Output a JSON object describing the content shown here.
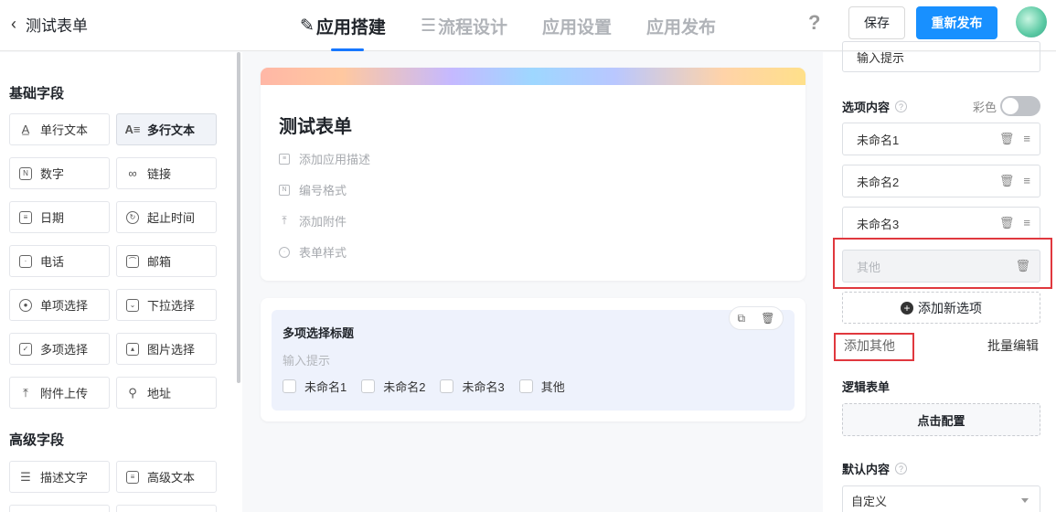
{
  "header": {
    "back_label": "测试表单",
    "tabs": [
      {
        "label": "应用搭建",
        "icon": "edit-icon"
      },
      {
        "label": "流程设计",
        "icon": "flow-icon"
      },
      {
        "label": "应用设置"
      },
      {
        "label": "应用发布"
      }
    ],
    "help": "?",
    "save_label": "保存",
    "publish_label": "重新发布"
  },
  "left": {
    "basic_title": "基础字段",
    "basic_fields": [
      {
        "label": "单行文本",
        "icon": "single-line-text-icon"
      },
      {
        "label": "多行文本",
        "icon": "multi-line-text-icon"
      },
      {
        "label": "数字",
        "icon": "number-icon"
      },
      {
        "label": "链接",
        "icon": "link-icon"
      },
      {
        "label": "日期",
        "icon": "calendar-icon"
      },
      {
        "label": "起止时间",
        "icon": "time-range-icon"
      },
      {
        "label": "电话",
        "icon": "phone-icon"
      },
      {
        "label": "邮箱",
        "icon": "mail-icon"
      },
      {
        "label": "单项选择",
        "icon": "radio-icon"
      },
      {
        "label": "下拉选择",
        "icon": "dropdown-icon"
      },
      {
        "label": "多项选择",
        "icon": "checkbox-icon"
      },
      {
        "label": "图片选择",
        "icon": "image-icon"
      },
      {
        "label": "附件上传",
        "icon": "upload-icon"
      },
      {
        "label": "地址",
        "icon": "location-icon"
      }
    ],
    "advanced_title": "高级字段",
    "advanced_fields": [
      {
        "label": "描述文字",
        "icon": "description-icon"
      },
      {
        "label": "高级文本",
        "icon": "rich-text-icon"
      }
    ]
  },
  "canvas": {
    "form_title": "测试表单",
    "meta": [
      {
        "label": "添加应用描述",
        "icon": "comment-icon"
      },
      {
        "label": "编号格式",
        "icon": "number-format-icon"
      },
      {
        "label": "添加附件",
        "icon": "upload-icon"
      },
      {
        "label": "表单样式",
        "icon": "palette-icon"
      }
    ],
    "question": {
      "title": "多项选择标题",
      "hint": "输入提示",
      "options": [
        "未命名1",
        "未命名2",
        "未命名3",
        "其他"
      ]
    }
  },
  "right": {
    "hint_input": "输入提示",
    "options_label": "选项内容",
    "color_label": "彩色",
    "color_on": false,
    "options": [
      "未命名1",
      "未命名2",
      "未命名3"
    ],
    "other_option": "其他",
    "add_option": "添加新选项",
    "add_other": "添加其他",
    "batch_edit": "批量编辑",
    "logic_label": "逻辑表单",
    "logic_button": "点击配置",
    "default_label": "默认内容",
    "default_value": "自定义"
  }
}
